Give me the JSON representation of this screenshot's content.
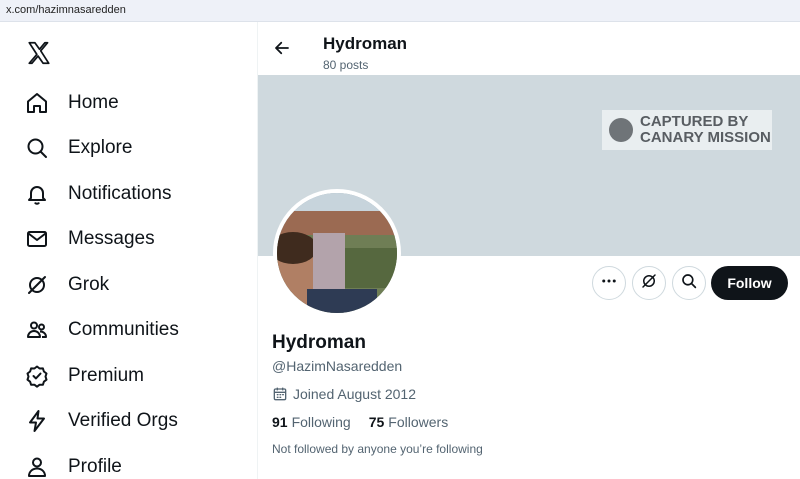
{
  "browser": {
    "url": "x.com/hazimnasaredden"
  },
  "sidebar": {
    "logo_icon": "x-logo-icon",
    "items": [
      {
        "label": "Home",
        "icon": "home-icon"
      },
      {
        "label": "Explore",
        "icon": "search-icon"
      },
      {
        "label": "Notifications",
        "icon": "bell-icon"
      },
      {
        "label": "Messages",
        "icon": "envelope-icon"
      },
      {
        "label": "Grok",
        "icon": "grok-icon"
      },
      {
        "label": "Communities",
        "icon": "people-icon"
      },
      {
        "label": "Premium",
        "icon": "verified-badge-icon"
      },
      {
        "label": "Verified Orgs",
        "icon": "lightning-icon"
      },
      {
        "label": "Profile",
        "icon": "person-icon"
      }
    ]
  },
  "header": {
    "title": "Hydroman",
    "post_count": "80 posts"
  },
  "banner": {
    "watermark_line1": "CAPTURED BY",
    "watermark_line2": "CANARY MISSION"
  },
  "actions": {
    "more_icon": "more-icon",
    "grok_icon": "grok-icon",
    "search_icon": "search-icon",
    "follow_label": "Follow"
  },
  "profile": {
    "display_name": "Hydroman",
    "handle": "@HazimNasaredden",
    "joined": "Joined August 2012",
    "following_count": "91",
    "following_label": "Following",
    "followers_count": "75",
    "followers_label": "Followers",
    "followed_by_note": "Not followed by anyone you’re following"
  },
  "colors": {
    "text": "#0f1419",
    "secondary": "#536471",
    "banner": "#cfd9de",
    "follow_bg": "#0f1419",
    "border": "#cfd9de"
  }
}
